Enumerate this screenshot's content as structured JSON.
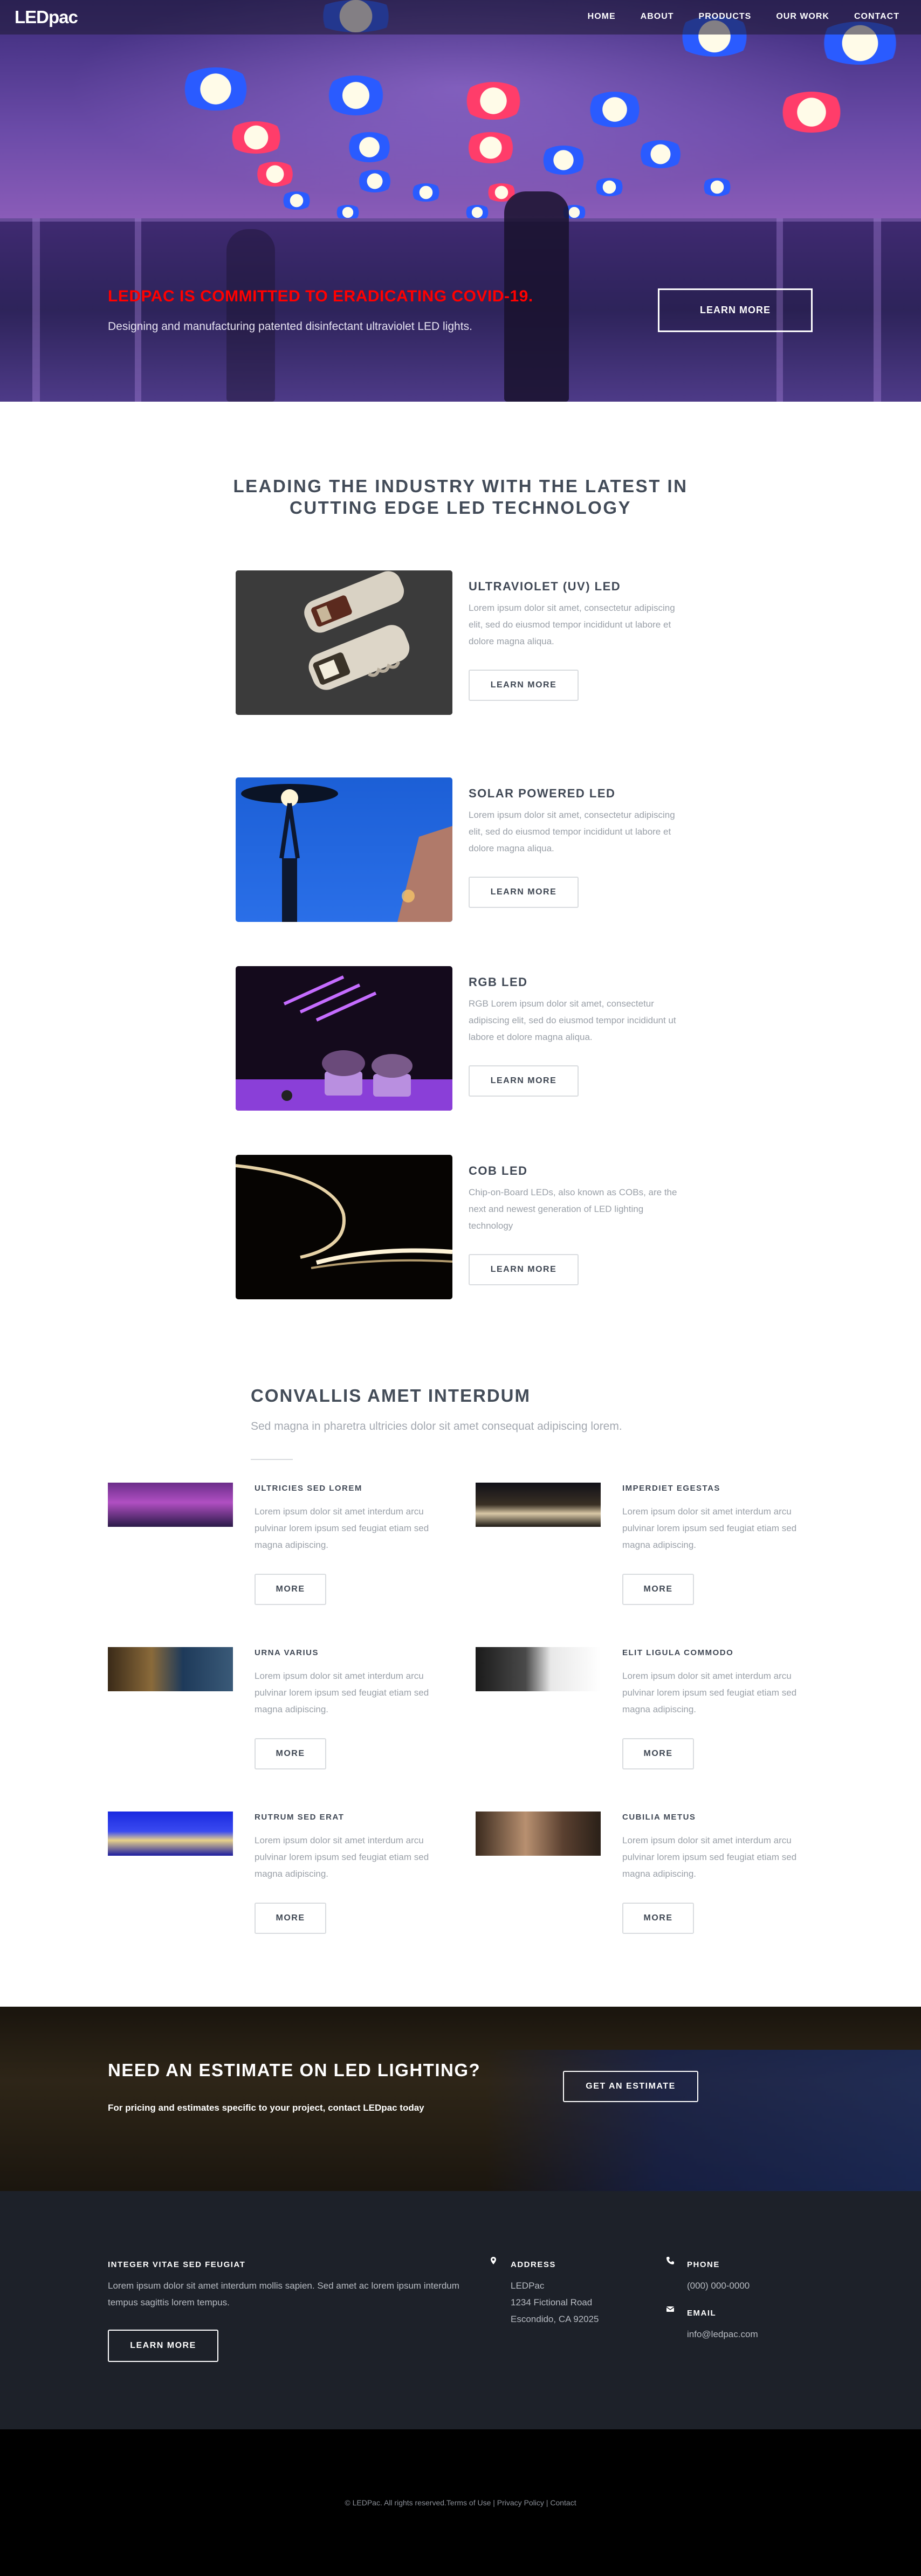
{
  "brand": {
    "logo_text": "LEDpac"
  },
  "nav": {
    "items": [
      "HOME",
      "ABOUT",
      "PRODUCTS",
      "OUR WORK",
      "CONTACT"
    ]
  },
  "hero": {
    "headline": "LEDPAC IS COMMITTED TO ERADICATING COVID-19.",
    "subtext": "Designing and manufacturing patented disinfectant ultraviolet LED lights.",
    "button": "LEARN MORE",
    "headline_color": "#ff0000"
  },
  "products": {
    "title": "LEADING THE INDUSTRY WITH THE LATEST IN CUTTING EDGE LED TECHNOLOGY",
    "items": [
      {
        "title": "ULTRAVIOLET (UV) LED",
        "desc": "Lorem ipsum dolor sit amet, consectetur adipiscing elit, sed do eiusmod tempor incididunt ut labore et dolore magna aliqua.",
        "button": "LEARN MORE",
        "image_icon": "uv-led-device"
      },
      {
        "title": "SOLAR POWERED LED",
        "desc": "Lorem ipsum dolor sit amet, consectetur adipiscing elit, sed do eiusmod tempor incididunt ut labore et dolore magna aliqua.",
        "button": "LEARN MORE",
        "image_icon": "street-lamp"
      },
      {
        "title": "RGB LED",
        "desc": "RGB Lorem ipsum dolor sit amet, consectetur adipiscing elit, sed do eiusmod tempor incididunt ut labore et dolore magna aliqua.",
        "button": "LEARN MORE",
        "image_icon": "grow-light"
      },
      {
        "title": "COB LED",
        "desc": "Chip-on-Board LEDs, also known as COBs, are the next and newest generation of LED lighting technology",
        "button": "LEARN MORE",
        "image_icon": "led-strip"
      }
    ]
  },
  "features": {
    "title": "CONVALLIS AMET INTERDUM",
    "subtitle": "Sed magna in pharetra ultricies dolor sit amet consequat adipiscing lorem.",
    "items": [
      {
        "title": "ULTRICIES SED LOREM",
        "desc": "Lorem ipsum dolor sit amet interdum arcu pulvinar lorem ipsum sed feugiat etiam sed magna adipiscing.",
        "button": "MORE"
      },
      {
        "title": "IMPERDIET EGESTAS",
        "desc": "Lorem ipsum dolor sit amet interdum arcu pulvinar lorem ipsum sed feugiat etiam sed magna adipiscing.",
        "button": "MORE"
      },
      {
        "title": "URNA VARIUS",
        "desc": "Lorem ipsum dolor sit amet interdum arcu pulvinar lorem ipsum sed feugiat etiam sed magna adipiscing.",
        "button": "MORE"
      },
      {
        "title": "ELIT LIGULA COMMODO",
        "desc": "Lorem ipsum dolor sit amet interdum arcu pulvinar lorem ipsum sed feugiat etiam sed magna adipiscing.",
        "button": "MORE"
      },
      {
        "title": "RUTRUM SED ERAT",
        "desc": "Lorem ipsum dolor sit amet interdum arcu pulvinar lorem ipsum sed feugiat etiam sed magna adipiscing.",
        "button": "MORE"
      },
      {
        "title": "CUBILIA METUS",
        "desc": "Lorem ipsum dolor sit amet interdum arcu pulvinar lorem ipsum sed feugiat etiam sed magna adipiscing.",
        "button": "MORE"
      }
    ]
  },
  "cta": {
    "title": "NEED AN ESTIMATE ON LED LIGHTING?",
    "subtext": "For pricing and estimates specific to your project, contact LEDpac today",
    "button": "GET AN ESTIMATE"
  },
  "footer": {
    "about_title": "INTEGER VITAE SED FEUGIAT",
    "about_text": "Lorem ipsum dolor sit amet interdum mollis sapien. Sed amet ac lorem ipsum interdum tempus sagittis lorem tempus.",
    "about_button": "LEARN MORE",
    "address_title": "ADDRESS",
    "address_lines": [
      "LEDPac",
      "1234 Fictional Road",
      "Escondido, CA 92025"
    ],
    "phone_title": "PHONE",
    "phone": "(000) 000-0000",
    "email_title": "EMAIL",
    "email": "info@ledpac.com",
    "icons": [
      "map-pin-icon",
      "phone-icon",
      "envelope-icon"
    ]
  },
  "copyright": "© LEDPac. All rights reserved.Terms of Use | Privacy Policy | Contact"
}
